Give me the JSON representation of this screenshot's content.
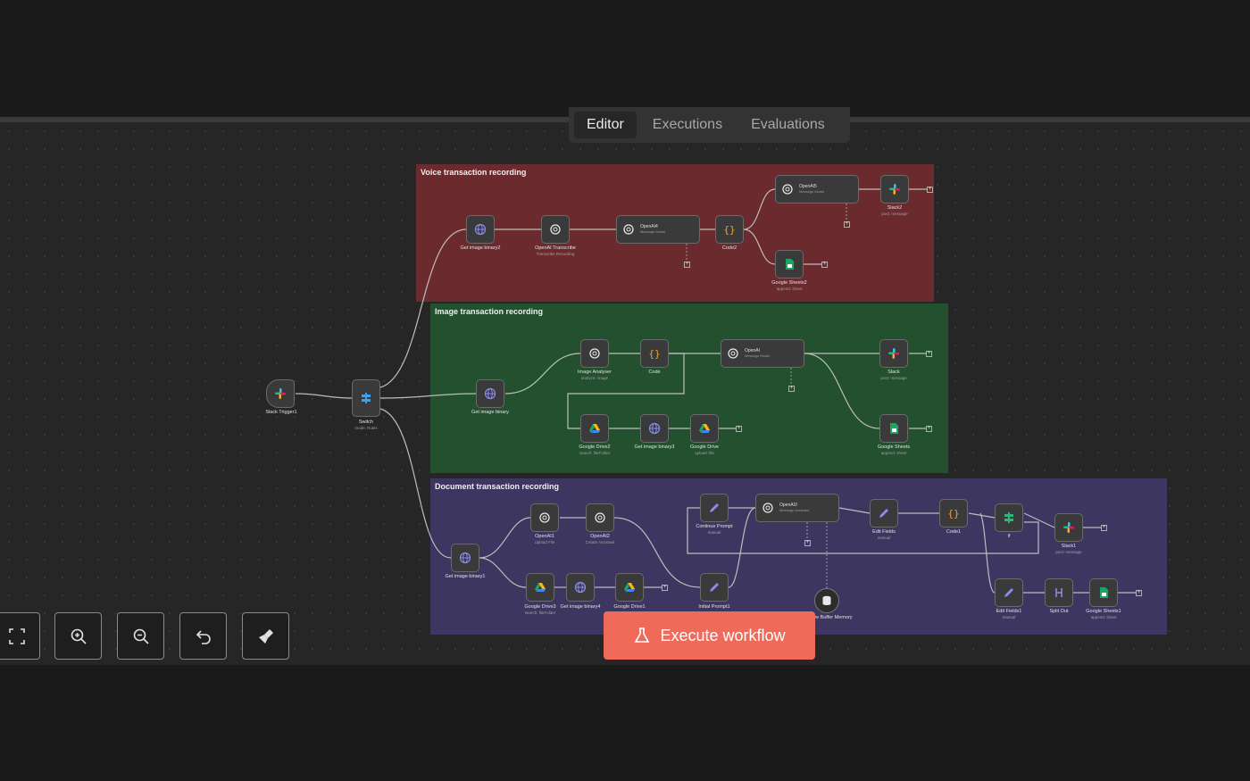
{
  "tabs": {
    "editor": "Editor",
    "executions": "Executions",
    "evaluations": "Evaluations"
  },
  "groups": {
    "voice": "Voice transaction recording",
    "image": "Image transaction recording",
    "document": "Document transaction recording"
  },
  "nodes": {
    "slack_trigger1": {
      "title": "Slack Trigger1"
    },
    "switch": {
      "title": "Switch",
      "sub": "mode: Rules"
    },
    "get_image_binary2": {
      "title": "Get image binary2"
    },
    "openai_transcribe": {
      "title": "OpenAI Transcribe",
      "sub": "Transcribe Recording"
    },
    "openai4": {
      "title": "OpenAI4",
      "sub": "Message Model"
    },
    "code2": {
      "title": "Code2"
    },
    "openai5": {
      "title": "OpenAI5",
      "sub": "Message Model"
    },
    "slack2": {
      "title": "Slack2",
      "sub": "post: message"
    },
    "google_sheets2": {
      "title": "Google Sheets2",
      "sub": "append: sheet"
    },
    "get_image_binary": {
      "title": "Get image binary"
    },
    "image_analyser": {
      "title": "Image Analyser",
      "sub": "analyze: image"
    },
    "code": {
      "title": "Code"
    },
    "openai": {
      "title": "OpenAI",
      "sub": "Message Model"
    },
    "slack": {
      "title": "Slack",
      "sub": "post: message"
    },
    "google_drive2": {
      "title": "Google Drive2",
      "sub": "search: fileFolder"
    },
    "get_image_binary3": {
      "title": "Get image binary3"
    },
    "google_drive": {
      "title": "Google Drive",
      "sub": "upload: file"
    },
    "google_sheets": {
      "title": "Google Sheets",
      "sub": "append: sheet"
    },
    "get_image_binary1": {
      "title": "Get image binary1"
    },
    "openai1": {
      "title": "OpenAI1",
      "sub": "Upload File"
    },
    "openai2": {
      "title": "OpenAI2",
      "sub": "Create Assistant"
    },
    "google_drive3": {
      "title": "Google Drive3",
      "sub": "search: fileFolder"
    },
    "get_image_binary4": {
      "title": "Get image binary4"
    },
    "google_drive1": {
      "title": "Google Drive1"
    },
    "continue_prompt": {
      "title": "Continue Prompt",
      "sub": "manual"
    },
    "initial_prompt1": {
      "title": "Initial Prompt1",
      "sub": "manual"
    },
    "openai3": {
      "title": "OpenAI3",
      "sub": "Message Assistant"
    },
    "edit_fields": {
      "title": "Edit Fields",
      "sub": "manual"
    },
    "code1": {
      "title": "Code1"
    },
    "if": {
      "title": "If"
    },
    "slack1": {
      "title": "Slack1",
      "sub": "post: message"
    },
    "edit_fields1": {
      "title": "Edit Fields1",
      "sub": "manual"
    },
    "split_out": {
      "title": "Split Out"
    },
    "google_sheets1": {
      "title": "Google Sheets1",
      "sub": "append: sheet"
    },
    "window_buffer_memory": {
      "title": "Window Buffer Memory"
    }
  },
  "toolbar": {
    "fit_view": "fit-view-icon",
    "zoom_in": "zoom-in-icon",
    "zoom_out": "zoom-out-icon",
    "reset_zoom": "undo-icon",
    "tidy_up": "broom-icon"
  },
  "execute_button": {
    "label": "Execute workflow"
  },
  "colors": {
    "voice_group": "#6b2a2e",
    "image_group": "#23502f",
    "document_group": "#3d3660",
    "execute_button": "#f06a5a",
    "canvas": "#262626"
  }
}
